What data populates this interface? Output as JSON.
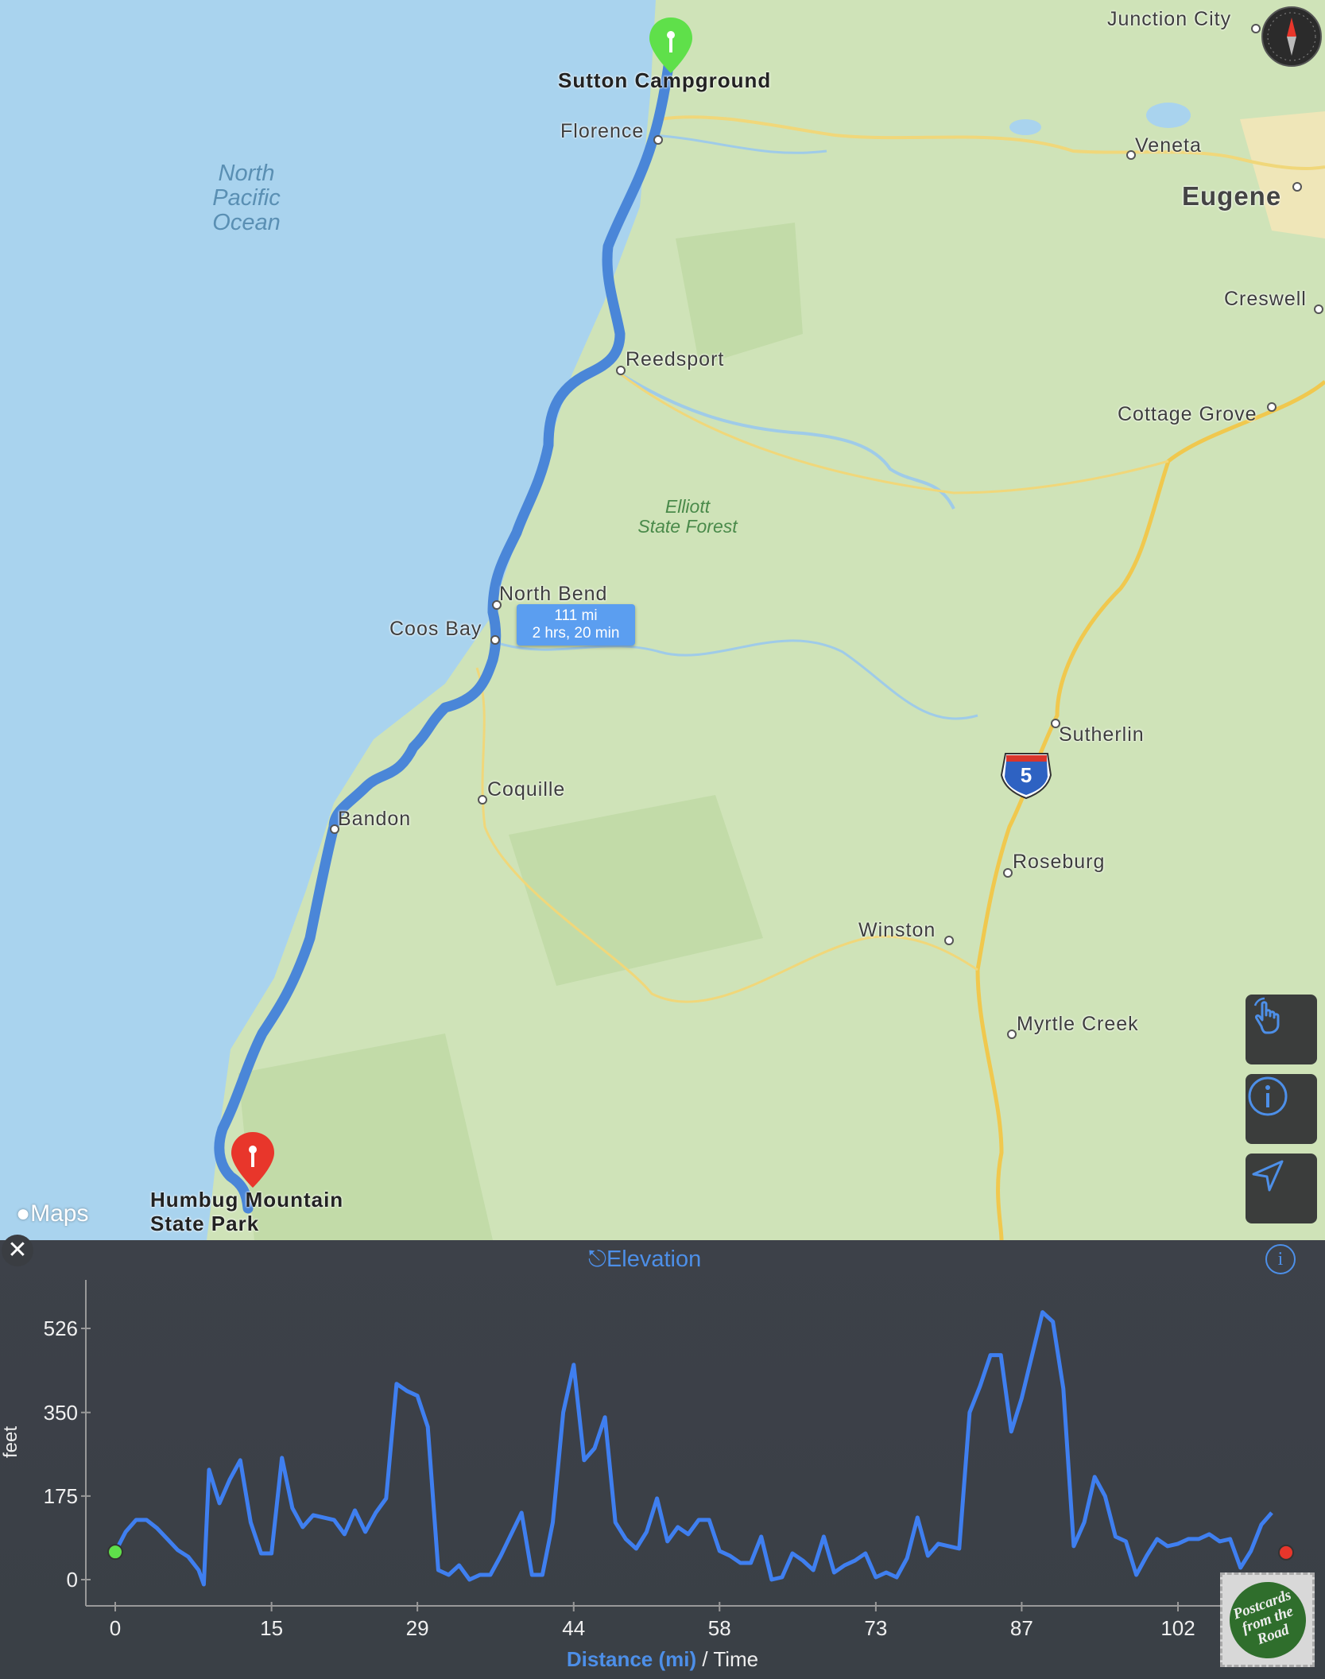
{
  "map": {
    "water_label": "North\nPacific\nOcean",
    "forest_label": "Elliott\nState Forest",
    "start_pin_label": "Sutton Campground",
    "end_pin_label": "Humbug Mountain\nState Park",
    "route_callout": {
      "distance": "111 mi",
      "duration": "2 hrs, 20 min"
    },
    "interstate_shield": "5",
    "attribution": "Maps",
    "places": {
      "junction_city": "Junction City",
      "florence": "Florence",
      "veneta": "Veneta",
      "eugene": "Eugene",
      "creswell": "Creswell",
      "reedsport": "Reedsport",
      "cottage_grove": "Cottage Grove",
      "north_bend": "North Bend",
      "coos_bay": "Coos Bay",
      "sutherlin": "Sutherlin",
      "coquille": "Coquille",
      "bandon": "Bandon",
      "roseburg": "Roseburg",
      "winston": "Winston",
      "myrtle_creek": "Myrtle Creek"
    },
    "colors": {
      "route": "#4a86d8",
      "start_pin": "#5fe04a",
      "end_pin": "#e8362b",
      "water": "#a9d3ee",
      "land": "#cfe3b8"
    }
  },
  "elevation_panel": {
    "title": "Elevation",
    "xlabel_primary": "Distance (mi)",
    "xlabel_secondary": " / Time",
    "ylabel": "feet",
    "stamp_text": "Postcards\nfrom the\nRoad",
    "close_symbol": "✕",
    "info_symbol": "i"
  },
  "chart_data": {
    "type": "line",
    "title": "Elevation",
    "xlabel": "Distance (mi) / Time",
    "ylabel": "feet",
    "xlim": [
      0,
      111
    ],
    "ylim": [
      0,
      580
    ],
    "x_ticks": [
      0,
      15,
      29,
      44,
      58,
      73,
      87,
      102
    ],
    "y_ticks": [
      0,
      175,
      350,
      526
    ],
    "grid": false,
    "series": [
      {
        "color": "#3f7ff0",
        "points": [
          [
            0,
            58
          ],
          [
            1,
            100
          ],
          [
            2,
            125
          ],
          [
            3,
            125
          ],
          [
            4,
            108
          ],
          [
            5,
            85
          ],
          [
            6,
            62
          ],
          [
            7,
            48
          ],
          [
            8,
            20
          ],
          [
            8.5,
            -10
          ],
          [
            9,
            230
          ],
          [
            10,
            160
          ],
          [
            11,
            210
          ],
          [
            12,
            250
          ],
          [
            13,
            120
          ],
          [
            14,
            55
          ],
          [
            15,
            55
          ],
          [
            16,
            255
          ],
          [
            17,
            150
          ],
          [
            18,
            110
          ],
          [
            19,
            135
          ],
          [
            20,
            130
          ],
          [
            21,
            125
          ],
          [
            22,
            95
          ],
          [
            23,
            145
          ],
          [
            24,
            100
          ],
          [
            25,
            140
          ],
          [
            26,
            170
          ],
          [
            27,
            410
          ],
          [
            28,
            395
          ],
          [
            29,
            385
          ],
          [
            30,
            320
          ],
          [
            31,
            20
          ],
          [
            32,
            10
          ],
          [
            33,
            30
          ],
          [
            34,
            0
          ],
          [
            35,
            10
          ],
          [
            36,
            10
          ],
          [
            37,
            50
          ],
          [
            38,
            95
          ],
          [
            39,
            140
          ],
          [
            40,
            10
          ],
          [
            41,
            10
          ],
          [
            42,
            120
          ],
          [
            43,
            350
          ],
          [
            44,
            450
          ],
          [
            45,
            250
          ],
          [
            46,
            275
          ],
          [
            47,
            340
          ],
          [
            48,
            120
          ],
          [
            49,
            85
          ],
          [
            50,
            65
          ],
          [
            51,
            100
          ],
          [
            52,
            170
          ],
          [
            53,
            80
          ],
          [
            54,
            110
          ],
          [
            55,
            95
          ],
          [
            56,
            125
          ],
          [
            57,
            125
          ],
          [
            58,
            60
          ],
          [
            59,
            50
          ],
          [
            60,
            35
          ],
          [
            61,
            35
          ],
          [
            62,
            90
          ],
          [
            63,
            0
          ],
          [
            64,
            5
          ],
          [
            65,
            55
          ],
          [
            66,
            40
          ],
          [
            67,
            20
          ],
          [
            68,
            90
          ],
          [
            69,
            15
          ],
          [
            70,
            30
          ],
          [
            71,
            40
          ],
          [
            72,
            55
          ],
          [
            73,
            5
          ],
          [
            74,
            15
          ],
          [
            75,
            5
          ],
          [
            76,
            45
          ],
          [
            77,
            130
          ],
          [
            78,
            50
          ],
          [
            79,
            75
          ],
          [
            80,
            70
          ],
          [
            81,
            65
          ],
          [
            82,
            350
          ],
          [
            83,
            405
          ],
          [
            84,
            470
          ],
          [
            85,
            470
          ],
          [
            86,
            310
          ],
          [
            87,
            380
          ],
          [
            88,
            470
          ],
          [
            89,
            560
          ],
          [
            90,
            540
          ],
          [
            91,
            400
          ],
          [
            92,
            70
          ],
          [
            93,
            120
          ],
          [
            94,
            215
          ],
          [
            95,
            175
          ],
          [
            96,
            90
          ],
          [
            97,
            80
          ],
          [
            98,
            10
          ],
          [
            99,
            50
          ],
          [
            100,
            85
          ],
          [
            101,
            70
          ],
          [
            102,
            75
          ],
          [
            103,
            85
          ],
          [
            104,
            85
          ],
          [
            105,
            95
          ],
          [
            106,
            80
          ],
          [
            107,
            85
          ],
          [
            108,
            25
          ],
          [
            109,
            60
          ],
          [
            110,
            115
          ],
          [
            111,
            140
          ]
        ]
      }
    ]
  }
}
